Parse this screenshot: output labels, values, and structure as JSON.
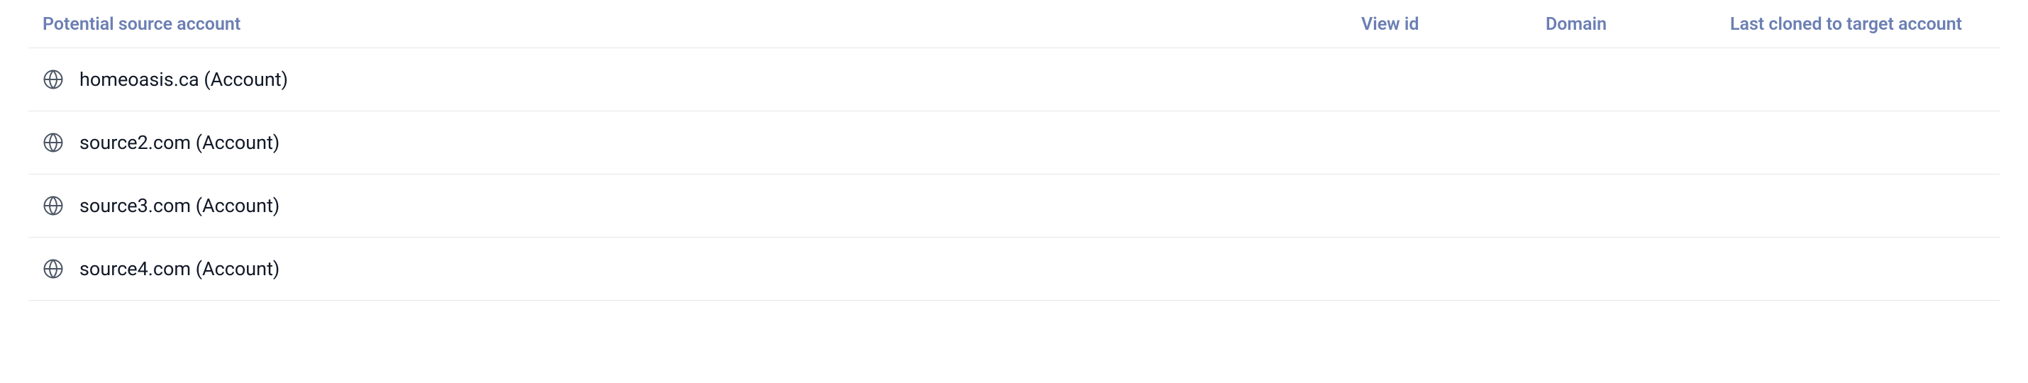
{
  "columns": {
    "source": "Potential source account",
    "view_id": "View id",
    "domain": "Domain",
    "last_cloned": "Last cloned to target account"
  },
  "rows": [
    {
      "label": "homeoasis.ca (Account)",
      "view_id": "",
      "domain": "",
      "last_cloned": ""
    },
    {
      "label": "source2.com (Account)",
      "view_id": "",
      "domain": "",
      "last_cloned": ""
    },
    {
      "label": "source3.com (Account)",
      "view_id": "",
      "domain": "",
      "last_cloned": ""
    },
    {
      "label": "source4.com (Account)",
      "view_id": "",
      "domain": "",
      "last_cloned": ""
    }
  ]
}
